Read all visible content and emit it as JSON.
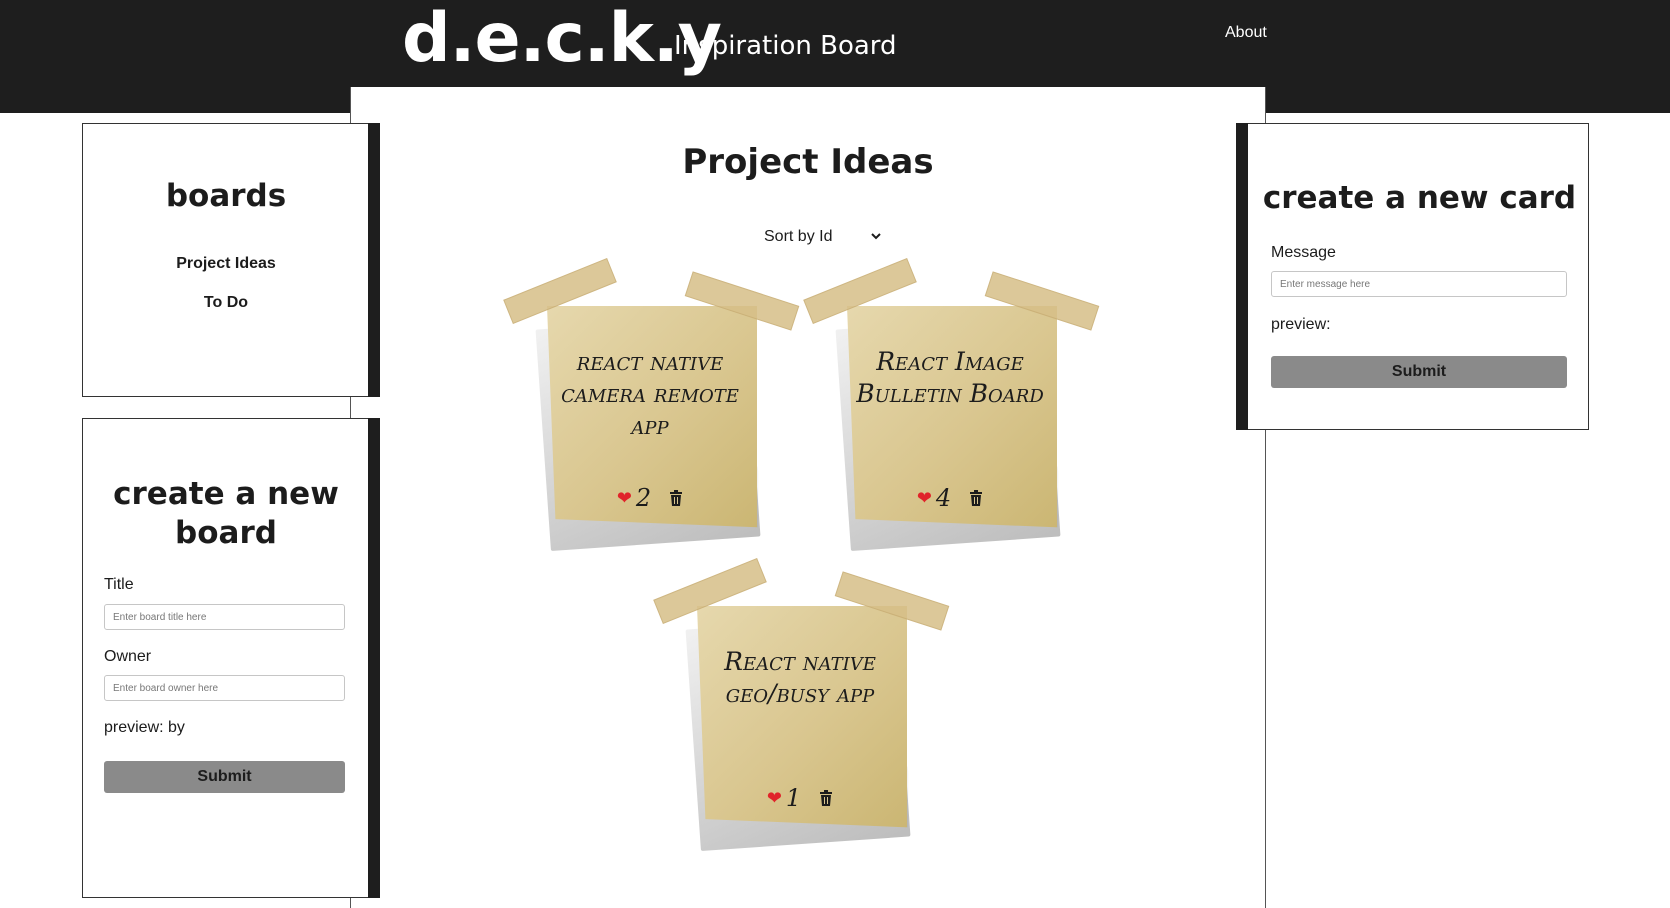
{
  "header": {
    "logo": "d.e.c.k.y",
    "subtitle": "Inspiration Board",
    "about_label": "About"
  },
  "boards_panel": {
    "title": "boards",
    "items": [
      {
        "label": "Project Ideas"
      },
      {
        "label": "To Do"
      }
    ]
  },
  "new_board_panel": {
    "title": "create a new board",
    "title_label": "Title",
    "title_placeholder": "Enter board title here",
    "owner_label": "Owner",
    "owner_placeholder": "Enter board owner here",
    "preview_label": "preview: by",
    "submit_label": "Submit"
  },
  "main": {
    "board_title": "Project Ideas",
    "sort": {
      "selected": "Sort by Id"
    },
    "cards": [
      {
        "message": "react native camera remote app",
        "likes": "2"
      },
      {
        "message": "React Image Bulletin Board",
        "likes": "4"
      },
      {
        "message": "React native geo/busy app",
        "likes": "1"
      }
    ]
  },
  "new_card_panel": {
    "title": "create a new card",
    "message_label": "Message",
    "message_placeholder": "Enter message here",
    "preview_label": "preview:",
    "submit_label": "Submit"
  },
  "colors": {
    "header_bg": "#1e1e1e",
    "note_paper": "#dccb93",
    "heart": "#e0242a",
    "submit_bg": "#8a8a8a"
  },
  "icons": {
    "like": "heart-icon",
    "delete": "trash-icon",
    "dropdown": "chevron-down-icon"
  }
}
